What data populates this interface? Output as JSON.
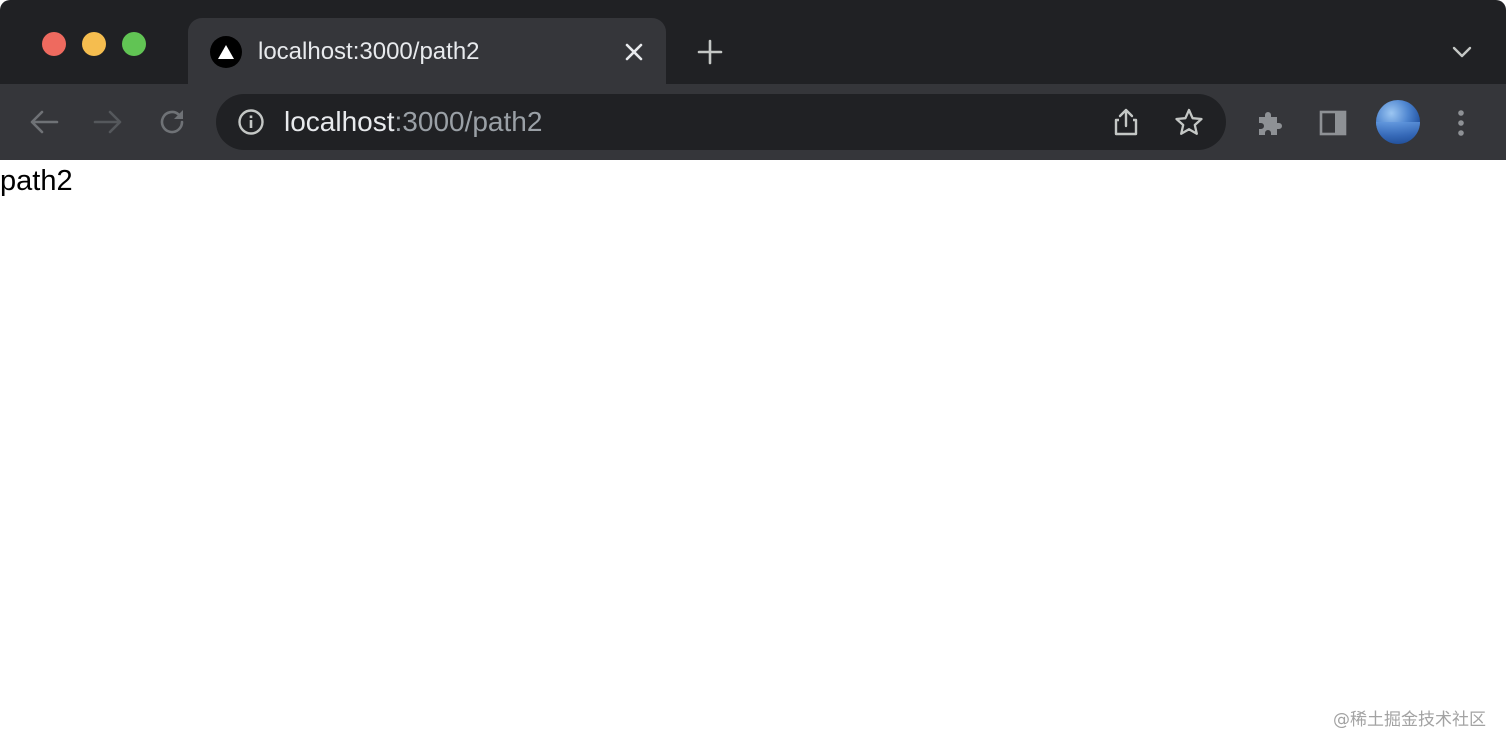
{
  "window": {
    "traffic_lights": {
      "close": "#ee6a5f",
      "minimize": "#f5bd4f",
      "zoom": "#61c454"
    }
  },
  "tab": {
    "title": "localhost:3000/path2",
    "favicon": "triangle-logo-icon"
  },
  "toolbar": {
    "url_host": "localhost",
    "url_rest": ":3000/path2"
  },
  "page": {
    "text": "path2"
  },
  "watermark": "@稀土掘金技术社区",
  "colors": {
    "tabstrip": "#202124",
    "toolbar": "#35363a",
    "omnibox": "#202124"
  }
}
